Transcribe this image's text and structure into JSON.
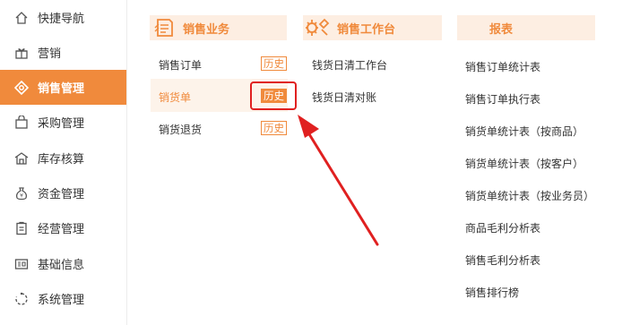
{
  "sidebar": {
    "items": [
      {
        "label": "快捷导航",
        "icon": "home-icon",
        "active": false
      },
      {
        "label": "营销",
        "icon": "gift-icon",
        "active": false
      },
      {
        "label": "销售管理",
        "icon": "sales-tag-icon",
        "active": true
      },
      {
        "label": "采购管理",
        "icon": "shopping-bag-icon",
        "active": false
      },
      {
        "label": "库存核算",
        "icon": "warehouse-icon",
        "active": false
      },
      {
        "label": "资金管理",
        "icon": "money-bag-icon",
        "active": false
      },
      {
        "label": "经营管理",
        "icon": "clipboard-icon",
        "active": false
      },
      {
        "label": "基础信息",
        "icon": "id-card-icon",
        "active": false
      },
      {
        "label": "系统管理",
        "icon": "settings-circle-icon",
        "active": false
      }
    ]
  },
  "columns": {
    "sales": {
      "title": "销售业务",
      "icon": "sales-document-icon",
      "items": [
        {
          "label": "销售订单",
          "badge": "历史"
        },
        {
          "label": "销货单",
          "badge": "历史"
        },
        {
          "label": "销货退货",
          "badge": "历史"
        }
      ]
    },
    "workbench": {
      "title": "销售工作台",
      "icon": "workbench-icon",
      "items": [
        {
          "label": "钱货日清工作台"
        },
        {
          "label": "钱货日清对账"
        }
      ]
    },
    "reports": {
      "title": "报表",
      "items": [
        {
          "label": "销售订单统计表"
        },
        {
          "label": "销售订单执行表"
        },
        {
          "label": "销货单统计表（按商品）"
        },
        {
          "label": "销货单统计表（按客户）"
        },
        {
          "label": "销货单统计表（按业务员）"
        },
        {
          "label": "商品毛利分析表"
        },
        {
          "label": "销售毛利分析表"
        },
        {
          "label": "销售排行榜"
        }
      ]
    }
  },
  "colors": {
    "accent": "#f08a3c",
    "header_bg": "#fdeee2",
    "annotation_red": "#e02020"
  }
}
